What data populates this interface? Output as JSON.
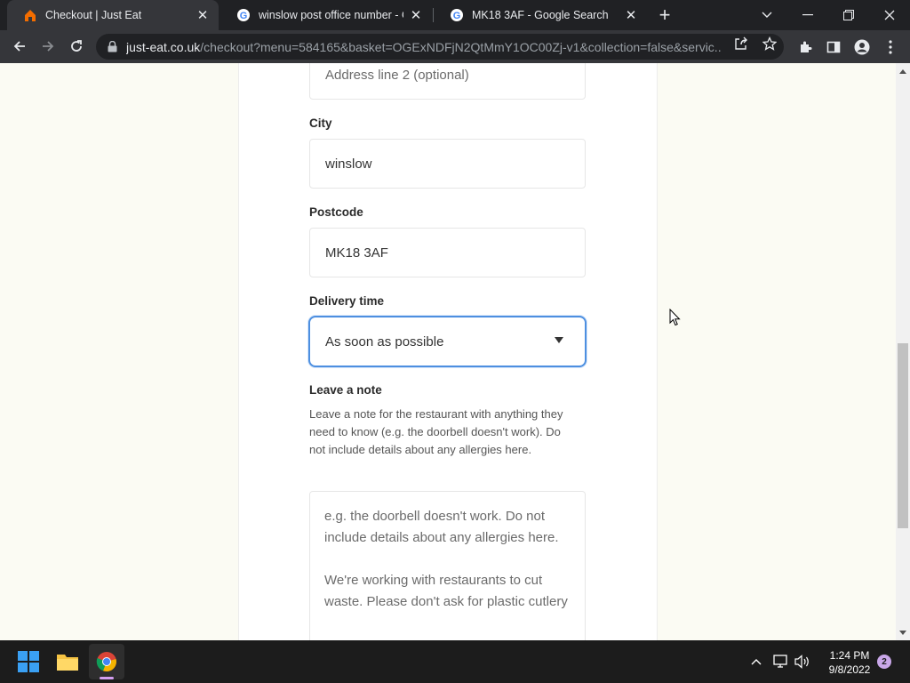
{
  "browser": {
    "tabs": [
      {
        "title": "Checkout | Just Eat",
        "favicon": "just-eat-icon",
        "active": true
      },
      {
        "title": "winslow post office number - Go",
        "favicon": "google-icon",
        "active": false
      },
      {
        "title": "MK18 3AF - Google Search",
        "favicon": "google-icon",
        "active": false
      }
    ],
    "url_host": "just-eat.co.uk",
    "url_path": "/checkout?menu=584165&basket=OGExNDFjN2QtMmY1OC00Zj-v1&collection=false&servic..."
  },
  "form": {
    "address_line2": {
      "placeholder": "Address line 2 (optional)"
    },
    "city": {
      "label": "City",
      "value": "winslow"
    },
    "postcode": {
      "label": "Postcode",
      "value": "MK18 3AF"
    },
    "delivery_time": {
      "label": "Delivery time",
      "selected": "As soon as possible"
    },
    "note": {
      "label": "Leave a note",
      "hint": "Leave a note for the restaurant with anything they need to know (e.g. the doorbell doesn't work). Do not include details about any allergies here.",
      "placeholder": "e.g. the doorbell doesn't work. Do not include details about any allergies here.\n\nWe're working with restaurants to cut waste. Please don't ask for plastic cutlery"
    }
  },
  "taskbar": {
    "time": "1:24 PM",
    "date": "9/8/2022",
    "notifications": "2"
  },
  "colors": {
    "focus_border": "#4d8fe0",
    "page_background": "#fbfbf3",
    "just_eat_orange": "#f36d00"
  }
}
